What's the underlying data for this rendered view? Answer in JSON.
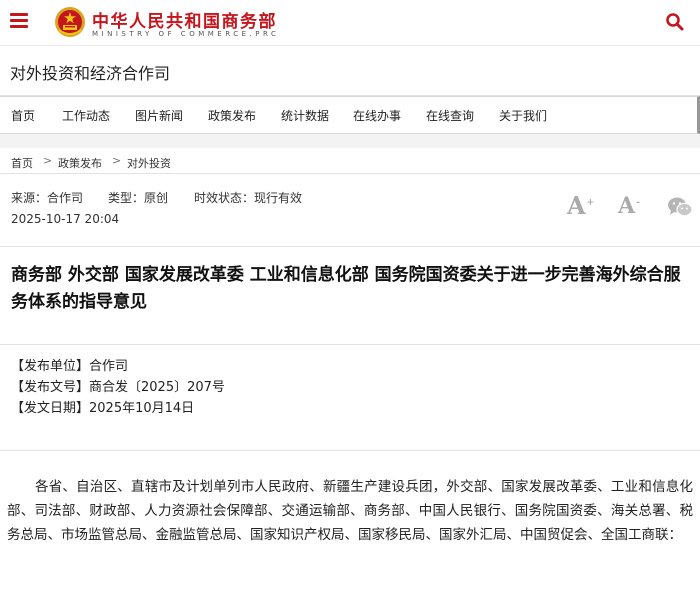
{
  "header": {
    "site_name_cn": "中华人民共和国商务部",
    "site_name_en": "MINISTRY OF COMMERCE.PRC",
    "accent_color": "#c4161c",
    "menu_icon": "hamburger-menu-icon",
    "search_icon": "search-icon",
    "emblem_icon": "national-emblem-icon"
  },
  "department": {
    "title": "对外投资和经济合作司"
  },
  "nav": {
    "items": [
      "首页",
      "工作动态",
      "图片新闻",
      "政策发布",
      "统计数据",
      "在线办事",
      "在线查询",
      "关于我们"
    ]
  },
  "breadcrumb": {
    "items": [
      "首页",
      "政策发布",
      "对外投资"
    ],
    "separator": ">"
  },
  "meta": {
    "source": "来源：合作司",
    "type": "类型：原创",
    "validity": "时效状态：现行有效",
    "date": "2025-10-17 20:04",
    "font_large_label": "A",
    "font_small_label": "A",
    "font_plus": "+",
    "font_minus": "-"
  },
  "article": {
    "title": "商务部 外交部 国家发展改革委 工业和信息化部 国务院国资委关于进一步完善海外综合服务体系的指导意见",
    "issuer": "【发布单位】合作司",
    "doc_number": "【发布文号】商合发〔2025〕207号",
    "issue_date": "【发文日期】2025年10月14日",
    "body": "各省、自治区、直辖市及计划单列市人民政府、新疆生产建设兵团，外交部、国家发展改革委、工业和信息化部、司法部、财政部、人力资源社会保障部、交通运输部、商务部、中国人民银行、国务院国资委、海关总署、税务总局、市场监管总局、金融监管总局、国家知识产权局、国家移民局、国家外汇局、中国贸促会、全国工商联："
  }
}
